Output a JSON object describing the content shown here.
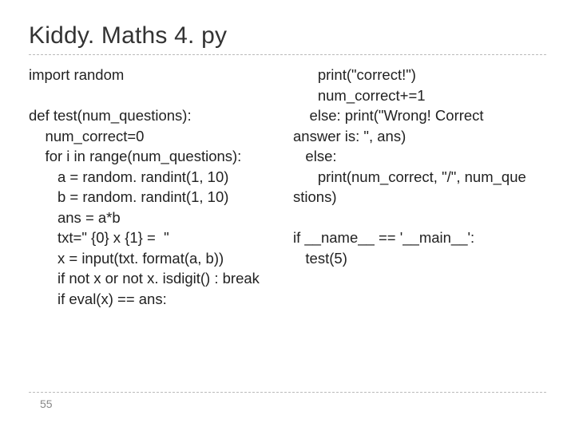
{
  "title": "Kiddy. Maths 4. py",
  "code": {
    "left": "import random\n\ndef test(num_questions):\n    num_correct=0\n    for i in range(num_questions):\n       a = random. randint(1, 10)\n       b = random. randint(1, 10)\n       ans = a*b\n       txt=\" {0} x {1} =  \"\n       x = input(txt. format(a, b))\n       if not x or not x. isdigit() : break\n       if eval(x) == ans:",
    "right": "      print(\"correct!\")\n      num_correct+=1\n    else: print(\"Wrong! Correct\nanswer is: \", ans)\n   else:\n      print(num_correct, \"/\", num_que\nstions)\n\nif __name__ == '__main__':\n   test(5)"
  },
  "page_number": "55"
}
